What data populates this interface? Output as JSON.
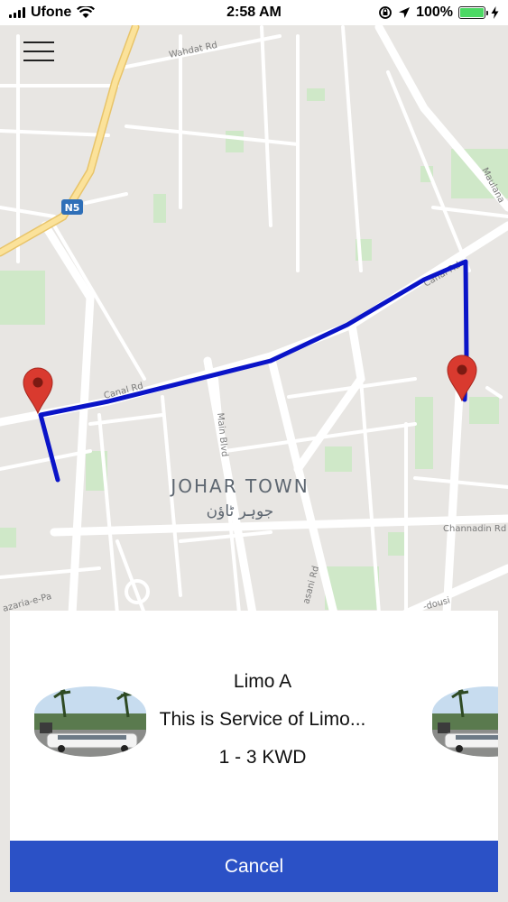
{
  "status_bar": {
    "carrier": "Ufone",
    "time": "2:58 AM",
    "battery": "100%"
  },
  "map": {
    "area_name": "JOHAR TOWN",
    "area_name_urdu": "جوہر ٹاؤن",
    "highway_shield": "N5",
    "roads": {
      "wahdat": "Wahdat Rd",
      "canal_left": "Canal Rd",
      "canal_right": "Canal Rd",
      "main_blvd": "Main Blvd",
      "channadin": "Channadin Rd",
      "maulana": "Maulana",
      "hasani": "asani Rd",
      "dousi": "-dousi",
      "nazaria": "azaria-e-Pa"
    },
    "route_color": "#0a14c8",
    "marker_color": "#d93a2f"
  },
  "menu": {
    "icon": "hamburger-menu-icon"
  },
  "service": {
    "name": "Limo A",
    "description": "This is Service of Limo...",
    "price": "1 - 3 KWD"
  },
  "actions": {
    "cancel_label": "Cancel",
    "cancel_color": "#2b51c6"
  }
}
